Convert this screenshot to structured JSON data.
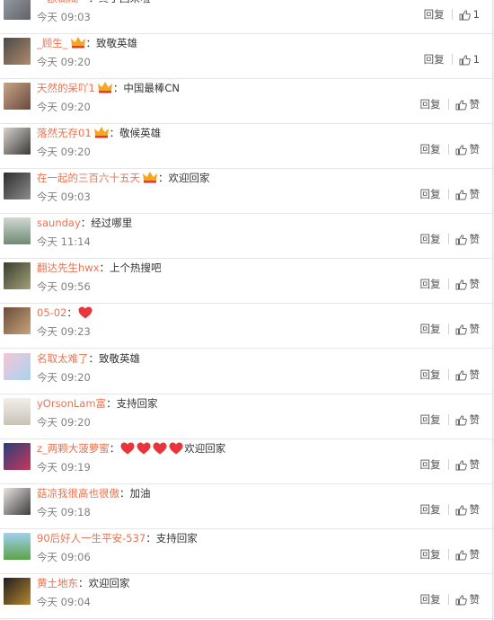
{
  "comments": [
    {
      "user": "一欧糊糊一",
      "text": "终于回来啦",
      "time": "今天 09:03",
      "reply": "回复",
      "like": "1",
      "badge": false,
      "hearts": 0
    },
    {
      "user": "_顾生_",
      "text": "致敬英雄",
      "time": "今天 09:20",
      "reply": "回复",
      "like": "1",
      "badge": true,
      "hearts": 0
    },
    {
      "user": "天然的呆吖1",
      "text": "中国最棒CN",
      "time": "今天 09:20",
      "reply": "回复",
      "like": "赞",
      "badge": true,
      "hearts": 0
    },
    {
      "user": "落然无存01",
      "text": "敬候英雄",
      "time": "今天 09:20",
      "reply": "回复",
      "like": "赞",
      "badge": true,
      "hearts": 0
    },
    {
      "user": "在一起的三百六十五天",
      "text": "欢迎回家",
      "time": "今天 09:03",
      "reply": "回复",
      "like": "赞",
      "badge": true,
      "hearts": 0
    },
    {
      "user": "saunday",
      "text": "经过哪里",
      "time": "今天 11:14",
      "reply": "回复",
      "like": "赞",
      "badge": false,
      "hearts": 0
    },
    {
      "user": "翻达先生hwx",
      "text": "上个热搜吧",
      "time": "今天 09:56",
      "reply": "回复",
      "like": "赞",
      "badge": false,
      "hearts": 0
    },
    {
      "user": "05-02",
      "text": "",
      "time": "今天 09:23",
      "reply": "回复",
      "like": "赞",
      "badge": false,
      "hearts": 1
    },
    {
      "user": "名取太难了",
      "text": "致敬英雄",
      "time": "今天 09:20",
      "reply": "回复",
      "like": "赞",
      "badge": false,
      "hearts": 0
    },
    {
      "user": "yOrsonLam富",
      "text": "支持回家",
      "time": "今天 09:20",
      "reply": "回复",
      "like": "赞",
      "badge": false,
      "hearts": 0
    },
    {
      "user": "z_两颗大菠萝蜜",
      "text": "欢迎回家",
      "time": "今天 09:19",
      "reply": "回复",
      "like": "赞",
      "badge": false,
      "hearts": 4
    },
    {
      "user": "菇凉我很高也很傲",
      "text": "加油",
      "time": "今天 09:18",
      "reply": "回复",
      "like": "赞",
      "badge": false,
      "hearts": 0
    },
    {
      "user": "90后好人一生平安-537",
      "text": "支持回家",
      "time": "今天 09:06",
      "reply": "回复",
      "like": "赞",
      "badge": false,
      "hearts": 0
    },
    {
      "user": "黄土地东",
      "text": "欢迎回家",
      "time": "今天 09:04",
      "reply": "回复",
      "like": "赞",
      "badge": false,
      "hearts": 0
    }
  ],
  "separator": "：",
  "colors": {
    "username": "#eb7350",
    "heart": "#e8343a",
    "badge": "#f5a623"
  }
}
